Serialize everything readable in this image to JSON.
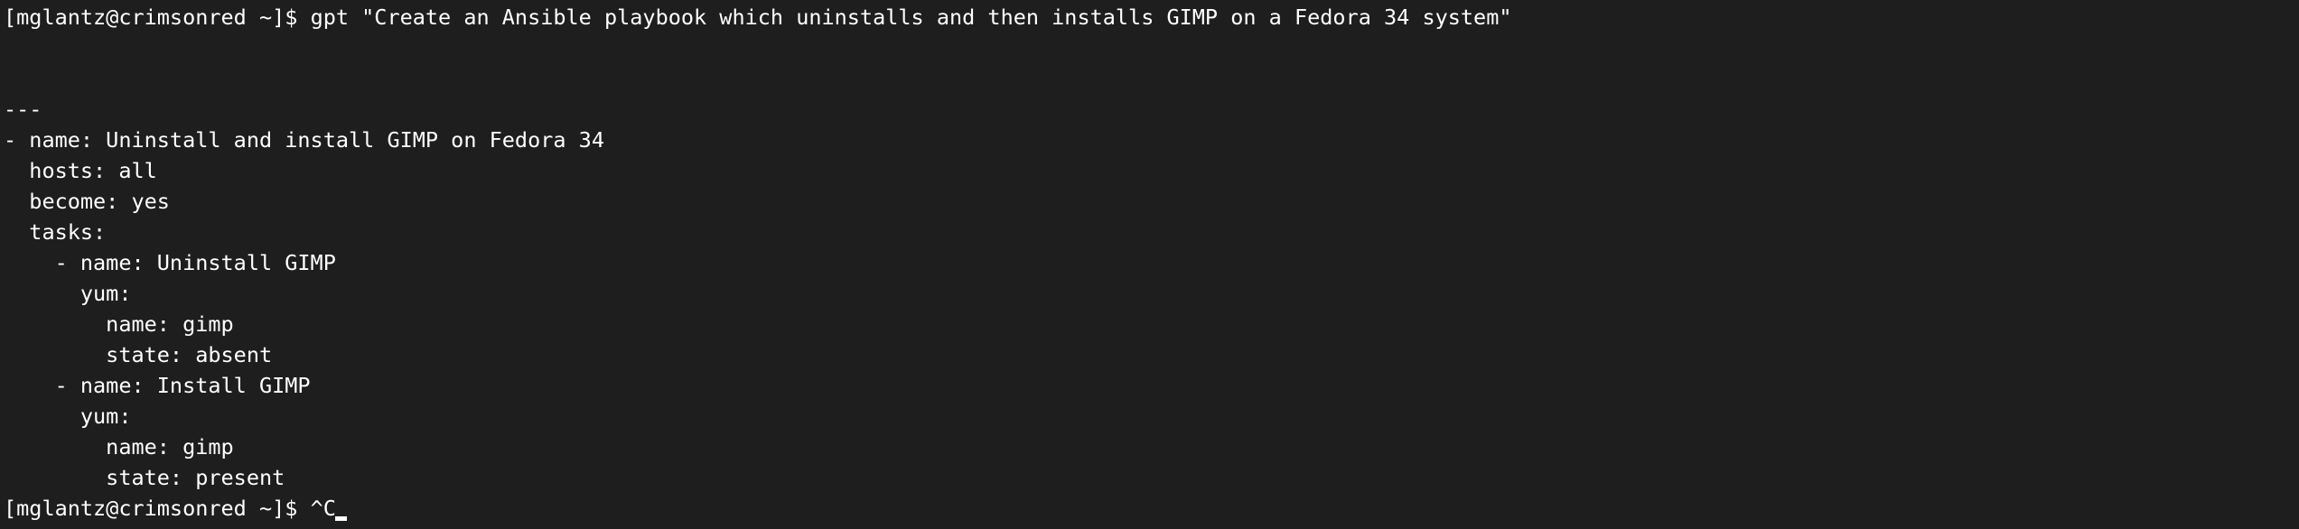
{
  "terminal": {
    "prompt_1": "[mglantz@crimsonred ~]$ ",
    "command": "gpt \"Create an Ansible playbook which uninstalls and then installs GIMP on a Fedora 34 system\"",
    "output": [
      "",
      "",
      "---",
      "- name: Uninstall and install GIMP on Fedora 34",
      "  hosts: all",
      "  become: yes",
      "  tasks:",
      "    - name: Uninstall GIMP",
      "      yum:",
      "        name: gimp",
      "        state: absent",
      "    - name: Install GIMP",
      "      yum:",
      "        name: gimp",
      "        state: present"
    ],
    "prompt_2": "[mglantz@crimsonred ~]$ ",
    "interrupt": "^C"
  }
}
